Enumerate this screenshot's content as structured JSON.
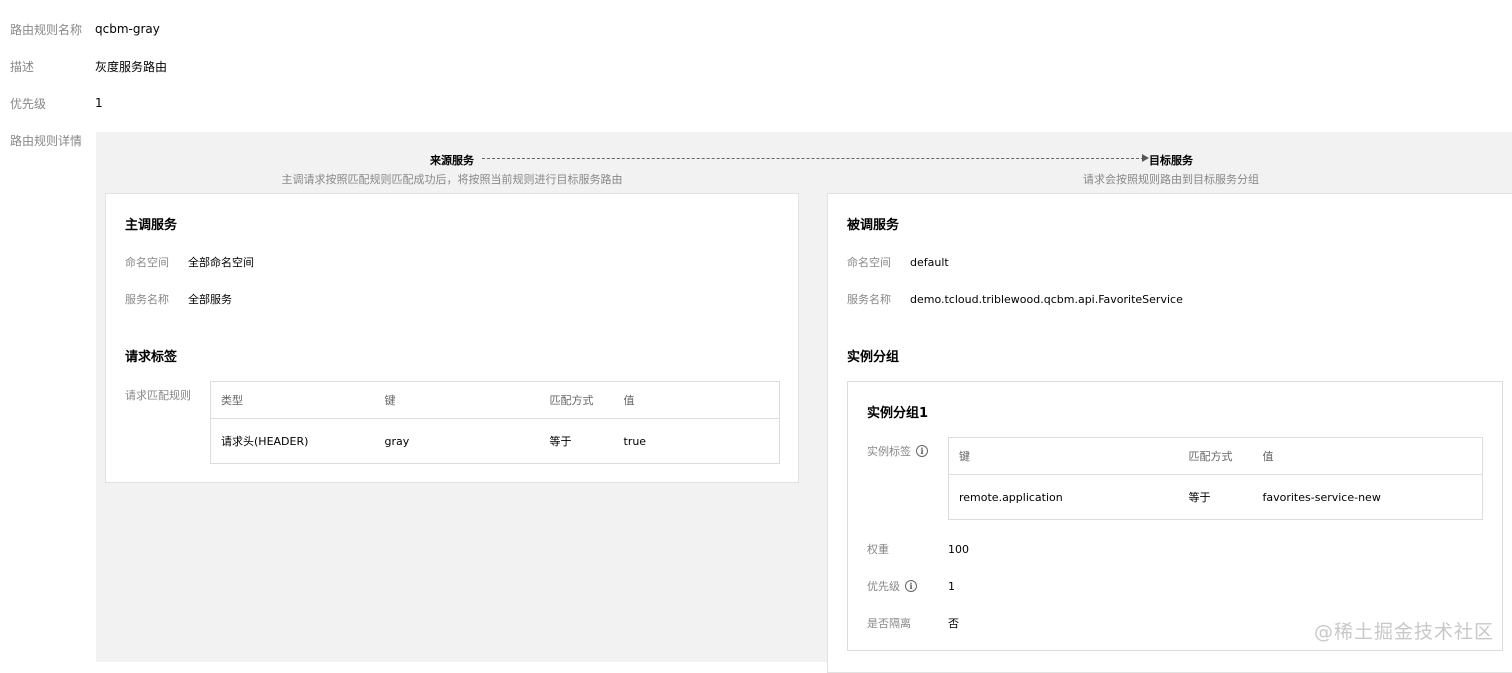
{
  "rule": {
    "name_label": "路由规则名称",
    "name_value": "qcbm-gray",
    "desc_label": "描述",
    "desc_value": "灰度服务路由",
    "priority_label": "优先级",
    "priority_value": "1",
    "detail_label": "路由规则详情"
  },
  "flow": {
    "source_title": "来源服务",
    "source_desc": "主调请求按照匹配规则匹配成功后，将按照当前规则进行目标服务路由",
    "target_title": "目标服务",
    "target_desc": "请求会按照规则路由到目标服务分组"
  },
  "caller": {
    "title": "主调服务",
    "namespace_label": "命名空间",
    "namespace_value": "全部命名空间",
    "service_label": "服务名称",
    "service_value": "全部服务",
    "tags_title": "请求标签",
    "match_label": "请求匹配规则",
    "table": {
      "headers": [
        "类型",
        "键",
        "匹配方式",
        "值"
      ],
      "rows": [
        [
          "请求头(HEADER)",
          "gray",
          "等于",
          "true"
        ]
      ]
    }
  },
  "callee": {
    "title": "被调服务",
    "namespace_label": "命名空间",
    "namespace_value": "default",
    "service_label": "服务名称",
    "service_value": "demo.tcloud.triblewood.qcbm.api.FavoriteService",
    "groups_title": "实例分组",
    "group": {
      "title": "实例分组1",
      "tag_label": "实例标签",
      "table": {
        "headers": [
          "键",
          "匹配方式",
          "值"
        ],
        "rows": [
          [
            "remote.application",
            "等于",
            "favorites-service-new"
          ]
        ]
      },
      "weight_label": "权重",
      "weight_value": "100",
      "priority_label": "优先级",
      "priority_value": "1",
      "isolate_label": "是否隔离",
      "isolate_value": "否"
    }
  },
  "watermark": "@稀土掘金技术社区"
}
